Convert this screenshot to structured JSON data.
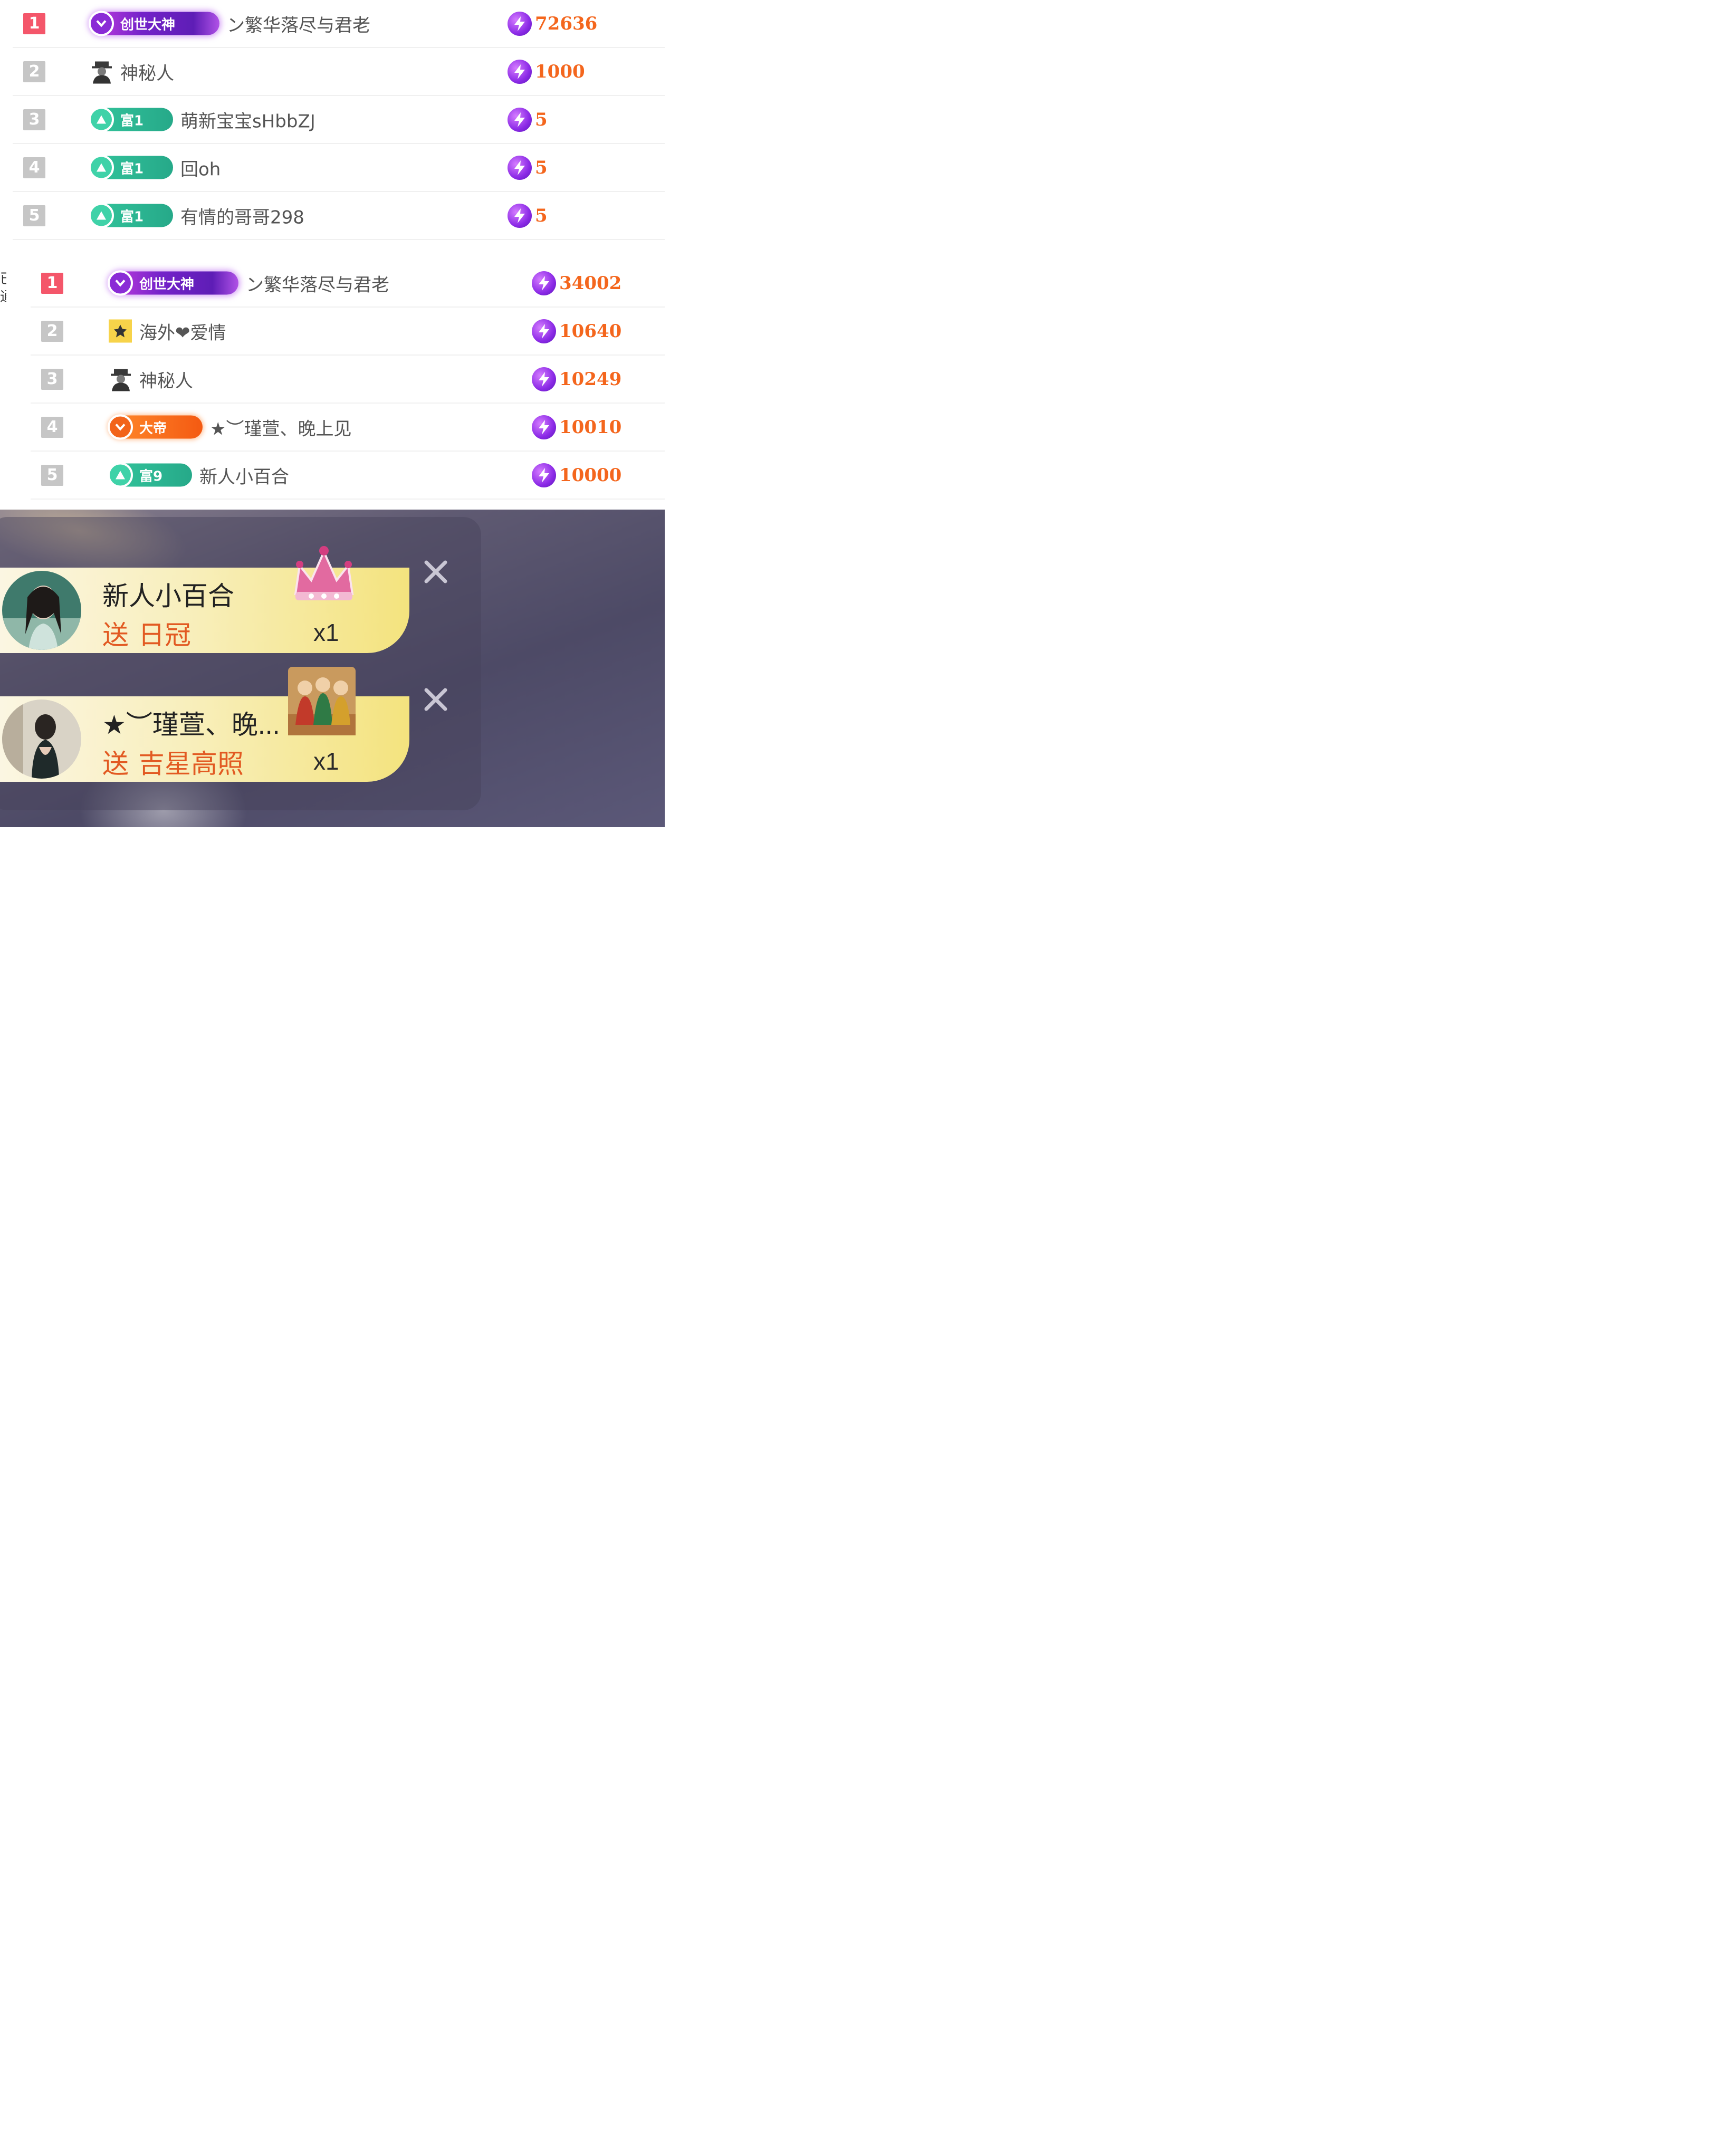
{
  "leaderboard_1": {
    "rows": [
      {
        "rank": "1",
        "badge": "创世大神",
        "name": "ン繁华落尽与君老",
        "score": "72636"
      },
      {
        "rank": "2",
        "badge": "",
        "name": "神秘人",
        "score": "1000"
      },
      {
        "rank": "3",
        "badge": "富1",
        "name": "萌新宝宝sHbbZJ",
        "score": "5"
      },
      {
        "rank": "4",
        "badge": "富1",
        "name": "回oh",
        "score": "5"
      },
      {
        "rank": "5",
        "badge": "富1",
        "name": "有情的哥哥298",
        "score": "5"
      }
    ]
  },
  "leaderboard_2": {
    "rows": [
      {
        "rank": "1",
        "badge": "创世大神",
        "name": "ン繁华落尽与君老",
        "score": "34002"
      },
      {
        "rank": "2",
        "badge": "",
        "name": "海外❤爱情",
        "score": "10640"
      },
      {
        "rank": "3",
        "badge": "",
        "name": "神秘人",
        "score": "10249"
      },
      {
        "rank": "4",
        "badge": "大帝",
        "name": "★︶瑾萱、晚上见",
        "score": "10010"
      },
      {
        "rank": "5",
        "badge": "富9",
        "name": "新人小百合",
        "score": "10000"
      }
    ]
  },
  "edge_text": "已通",
  "gift_notifications": [
    {
      "sender": "新人小百合",
      "verb": "送",
      "gift": "日冠",
      "quantity": "x1",
      "gift_image": "crown-icon"
    },
    {
      "sender": "★︶瑾萱、晚...",
      "verb": "送",
      "gift": "吉星高照",
      "quantity": "x1",
      "gift_image": "lucky-star-gift-icon"
    }
  ],
  "colors": {
    "rank_top": "#f4566a",
    "rank_other": "#c6c6c6",
    "score": "#f4661d",
    "gift_text": "#e25a22",
    "badge_god": "#7422c9",
    "badge_rich": "#26a989",
    "badge_emperor": "#f45a12"
  }
}
